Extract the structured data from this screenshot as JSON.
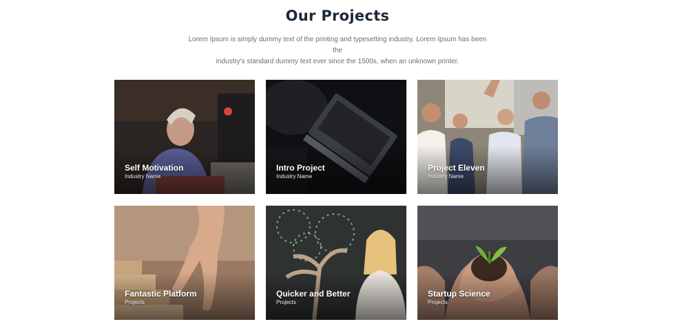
{
  "section": {
    "title": "Our Projects",
    "intro_line1": "Lorem Ipsum is simply dummy text of the printing and typesetting industry. Lorem Ipsum has been the",
    "intro_line2": "industry's standard dummy text ever since the 1500s, when an unknown printer."
  },
  "projects": [
    {
      "title": "Self Motivation",
      "subtitle": "Industry Name",
      "image": "woman-at-desk-photo"
    },
    {
      "title": "Intro Project",
      "subtitle": "Industry Name",
      "image": "laptop-dark-photo"
    },
    {
      "title": "Project Eleven",
      "subtitle": "Industry Name",
      "image": "team-high-five-photo"
    },
    {
      "title": "Fantastic Platform",
      "subtitle": "Projects",
      "image": "hand-walking-steps-photo"
    },
    {
      "title": "Quicker and Better",
      "subtitle": "Projects",
      "image": "money-tree-chalkboard-photo"
    },
    {
      "title": "Startup Science",
      "subtitle": "Projects",
      "image": "hands-holding-sprout-photo"
    }
  ]
}
